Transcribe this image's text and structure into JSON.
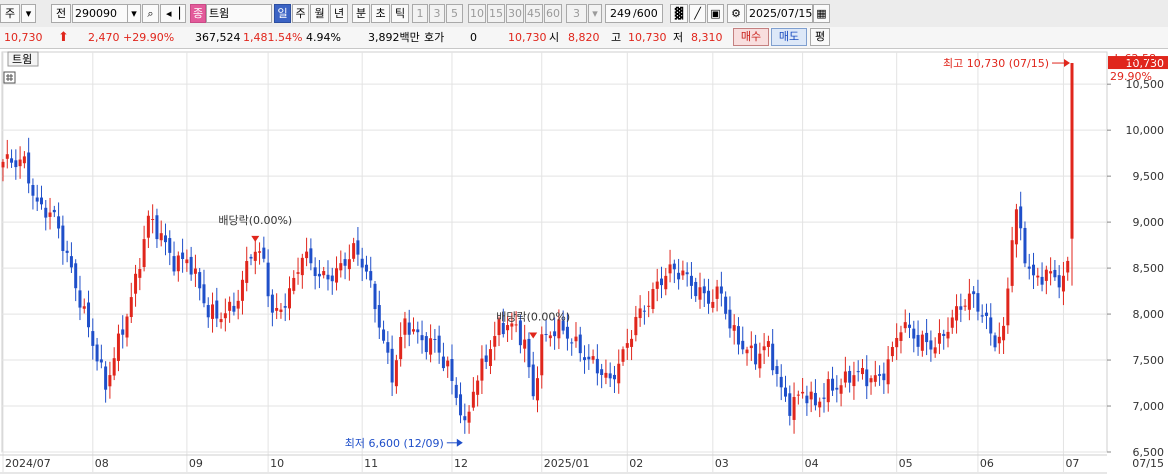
{
  "toolbar": {
    "market_label": "주",
    "prev_label": "전",
    "stock_code": "290090",
    "stock_name": "트윔",
    "stock_badge": "종",
    "period_day": "일",
    "period_week": "주",
    "period_month": "월",
    "period_year": "년",
    "period_minute": "분",
    "period_second": "초",
    "period_tick": "틱",
    "intervals": [
      "1",
      "3",
      "5",
      "10",
      "15",
      "30",
      "45",
      "60"
    ],
    "interval_value": "3",
    "count_value": "249",
    "count_total": "/600",
    "date_value": "2025/07/15"
  },
  "quote": {
    "price": "10,730",
    "change": "2,470",
    "change_pct": "+29.90%",
    "volume": "367,524",
    "volume_pct": "1,481.54%",
    "turnover_pct": "4.94%",
    "amount": "3,892백만",
    "bid_label": "호가",
    "bid_value": "0",
    "ask_price": "10,730",
    "open_label": "시",
    "open_value": "8,820",
    "high_label": "고",
    "high_value": "10,730",
    "low_label": "저",
    "low_value": "8,310",
    "buy_label": "매수",
    "sell_label": "매도",
    "eval_label": "평"
  },
  "colors": {
    "up": "#e0261c",
    "down": "#1f4fc9",
    "grid": "#e3e3e3"
  },
  "chart_data": {
    "type": "candlestick",
    "legend_label": "트윔",
    "ylim": [
      6500,
      10850
    ],
    "yticks": [
      6500,
      7000,
      7500,
      8000,
      8500,
      9000,
      9500,
      10000,
      10500
    ],
    "ytick_labels": [
      "6,500",
      "7,000",
      "7,500",
      "8,000",
      "8,500",
      "9,000",
      "9,500",
      "10,000",
      "10,500"
    ],
    "month_ticks": [
      {
        "label": "2024/07",
        "index": 0
      },
      {
        "label": "08",
        "index": 21
      },
      {
        "label": "09",
        "index": 43
      },
      {
        "label": "10",
        "index": 62
      },
      {
        "label": "11",
        "index": 84
      },
      {
        "label": "12",
        "index": 105
      },
      {
        "label": "2025/01",
        "index": 126
      },
      {
        "label": "02",
        "index": 146
      },
      {
        "label": "03",
        "index": 166
      },
      {
        "label": "04",
        "index": 187
      },
      {
        "label": "05",
        "index": 209
      },
      {
        "label": "06",
        "index": 228
      },
      {
        "label": "07",
        "index": 248
      }
    ],
    "last_date_label": "07/15",
    "current_price_label": "10,730",
    "current_change_label": "29.90%",
    "top_right_label": "L:62.58",
    "annotations": {
      "high_label": "최고 10,730 (07/15)",
      "low_label": "최저 6,600 (12/09)",
      "dividend1_label": "배당락(0.00%)",
      "dividend2_label": "배당락(0.00%)"
    },
    "anchors": [
      [
        0,
        9600
      ],
      [
        5,
        9700
      ],
      [
        8,
        9200
      ],
      [
        12,
        9000
      ],
      [
        16,
        8500
      ],
      [
        19,
        8050
      ],
      [
        22,
        7500
      ],
      [
        24,
        7150
      ],
      [
        27,
        7700
      ],
      [
        31,
        8400
      ],
      [
        34,
        9000
      ],
      [
        37,
        8800
      ],
      [
        40,
        8600
      ],
      [
        43,
        8650
      ],
      [
        46,
        8250
      ],
      [
        48,
        7950
      ],
      [
        51,
        8000
      ],
      [
        55,
        8200
      ],
      [
        58,
        8650
      ],
      [
        61,
        8550
      ],
      [
        63,
        8000
      ],
      [
        67,
        8250
      ],
      [
        70,
        8600
      ],
      [
        74,
        8400
      ],
      [
        78,
        8500
      ],
      [
        82,
        8650
      ],
      [
        85,
        8450
      ],
      [
        88,
        7950
      ],
      [
        91,
        7350
      ],
      [
        94,
        7850
      ],
      [
        98,
        7700
      ],
      [
        101,
        7750
      ],
      [
        104,
        7400
      ],
      [
        107,
        6900
      ],
      [
        108,
        6700
      ],
      [
        110,
        7200
      ],
      [
        113,
        7600
      ],
      [
        116,
        7850
      ],
      [
        120,
        7800
      ],
      [
        122,
        7700
      ],
      [
        124,
        7150
      ],
      [
        126,
        7750
      ],
      [
        130,
        7800
      ],
      [
        135,
        7650
      ],
      [
        138,
        7500
      ],
      [
        142,
        7200
      ],
      [
        145,
        7550
      ],
      [
        148,
        8000
      ],
      [
        152,
        8200
      ],
      [
        156,
        8450
      ],
      [
        159,
        8500
      ],
      [
        162,
        8300
      ],
      [
        165,
        8100
      ],
      [
        168,
        8200
      ],
      [
        170,
        7900
      ],
      [
        173,
        7700
      ],
      [
        176,
        7500
      ],
      [
        179,
        7600
      ],
      [
        182,
        7200
      ],
      [
        184,
        7050
      ],
      [
        187,
        7150
      ],
      [
        190,
        6950
      ],
      [
        193,
        7200
      ],
      [
        196,
        7300
      ],
      [
        199,
        7350
      ],
      [
        202,
        7250
      ],
      [
        205,
        7300
      ],
      [
        208,
        7650
      ],
      [
        210,
        7900
      ],
      [
        214,
        7650
      ],
      [
        218,
        7700
      ],
      [
        221,
        7900
      ],
      [
        224,
        8050
      ],
      [
        227,
        8150
      ],
      [
        230,
        7950
      ],
      [
        232,
        7750
      ],
      [
        234,
        7800
      ],
      [
        235,
        8300
      ],
      [
        236,
        8800
      ],
      [
        237,
        9050
      ],
      [
        239,
        8600
      ],
      [
        241,
        8400
      ],
      [
        244,
        8500
      ],
      [
        246,
        8400
      ],
      [
        247,
        8350
      ],
      [
        248,
        8300
      ],
      [
        249,
        8500
      ],
      [
        250,
        8310
      ]
    ],
    "last_candle": {
      "open": 8820,
      "high": 10730,
      "low": 8310,
      "close": 10730
    }
  }
}
